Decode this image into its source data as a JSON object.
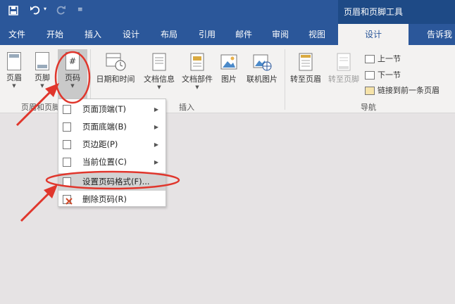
{
  "titlebar": {
    "contextual_tab_group": "页眉和页脚工具"
  },
  "tabs": [
    {
      "label": "文件"
    },
    {
      "label": "开始"
    },
    {
      "label": "插入"
    },
    {
      "label": "设计"
    },
    {
      "label": "布局"
    },
    {
      "label": "引用"
    },
    {
      "label": "邮件"
    },
    {
      "label": "审阅"
    },
    {
      "label": "视图"
    },
    {
      "label": "设计"
    },
    {
      "label": "告诉我"
    }
  ],
  "ribbon": {
    "header": "页眉",
    "footer": "页脚",
    "page_number": "页码",
    "group1_label": "页眉和页脚",
    "date_time": "日期和时间",
    "doc_info": "文档信息",
    "doc_parts": "文档部件",
    "picture": "图片",
    "online_picture": "联机图片",
    "group2_label": "插入",
    "goto_header": "转至页眉",
    "goto_footer": "转至页脚",
    "prev_section": "上一节",
    "next_section": "下一节",
    "link_prev": "链接到前一条页眉",
    "group3_label": "导航"
  },
  "menu": {
    "items": [
      {
        "label": "页面顶端(T)"
      },
      {
        "label": "页面底端(B)"
      },
      {
        "label": "页边距(P)"
      },
      {
        "label": "当前位置(C)"
      },
      {
        "label": "设置页码格式(F)..."
      },
      {
        "label": "删除页码(R)"
      }
    ]
  },
  "colors": {
    "brand": "#2b579a",
    "annotation": "#e0362c"
  }
}
